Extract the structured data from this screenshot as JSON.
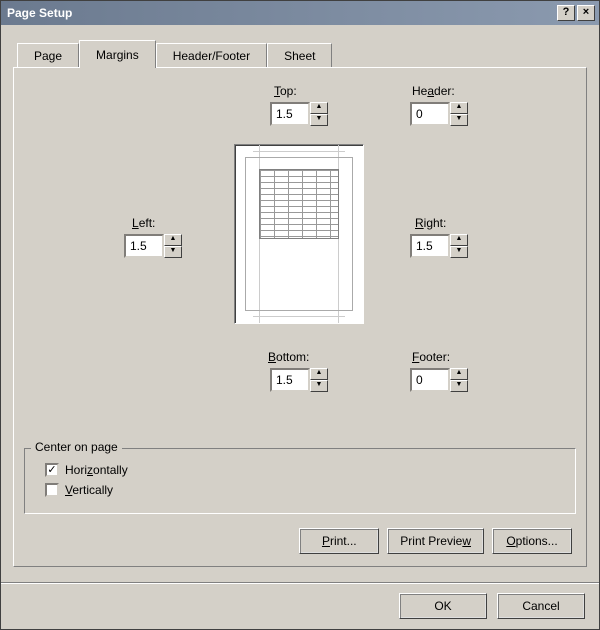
{
  "title": "Page Setup",
  "titlebar": {
    "help": "?",
    "close": "×"
  },
  "tabs": [
    {
      "label": "Page"
    },
    {
      "label": "Margins"
    },
    {
      "label": "Header/Footer"
    },
    {
      "label": "Sheet"
    }
  ],
  "active_tab_index": 1,
  "margins": {
    "top": {
      "label": "Top:",
      "underline": "T",
      "value": "1.5"
    },
    "header": {
      "label": "Header:",
      "underline": "A",
      "value": "0"
    },
    "left": {
      "label": "Left:",
      "underline": "L",
      "value": "1.5"
    },
    "right": {
      "label": "Right:",
      "underline": "R",
      "value": "1.5"
    },
    "bottom": {
      "label": "Bottom:",
      "underline": "B",
      "value": "1.5"
    },
    "footer": {
      "label": "Footer:",
      "underline": "F",
      "value": "0"
    }
  },
  "center": {
    "legend": "Center on page",
    "horizontally": {
      "label": "Horizontally",
      "underline": "Z",
      "checked": true
    },
    "vertically": {
      "label": "Vertically",
      "underline": "V",
      "checked": false
    }
  },
  "buttons": {
    "print": "Print...",
    "preview": "Print Preview",
    "options": "Options...",
    "ok": "OK",
    "cancel": "Cancel"
  }
}
